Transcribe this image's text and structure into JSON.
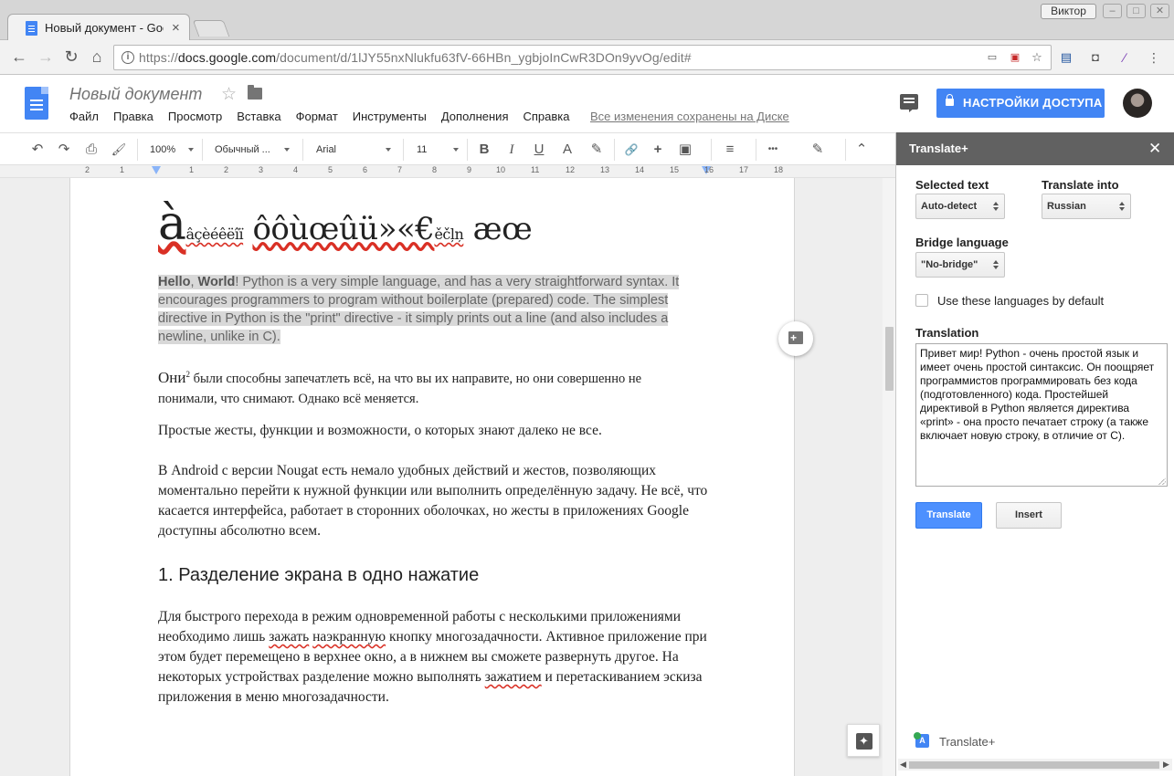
{
  "browser": {
    "tab_title": "Новый документ - Google Docs",
    "tab_close": "×",
    "user_name": "Виктор",
    "window_buttons": [
      "–",
      "□",
      "✕"
    ],
    "nav": {
      "back": "←",
      "forward": "→",
      "reload": "↻",
      "home": "⌂"
    },
    "url_prefix": "https://",
    "url_host": "docs.google.com",
    "url_path": "/document/d/1lJY55nxNlukfu63fV-66HBn_ygbjoInCwR3DOn9yvOg/edit#",
    "star": "☆",
    "menu_dots": "⋮"
  },
  "docs": {
    "title": "Новый документ",
    "star": "☆",
    "menu": [
      "Файл",
      "Правка",
      "Просмотр",
      "Вставка",
      "Формат",
      "Инструменты",
      "Дополнения",
      "Справка"
    ],
    "save_status": "Все изменения сохранены на Диске",
    "share_button": "НАСТРОЙКИ ДОСТУПА"
  },
  "toolbar": {
    "undo": "↶",
    "redo": "↷",
    "print": "⎙",
    "paint_format": "🖌",
    "zoom": "100%",
    "style": "Обычный ...",
    "font": "Arial",
    "size": "11",
    "bold": "B",
    "italic": "I",
    "underline": "U",
    "text_color": "A",
    "highlight": "✎",
    "link": "🔗",
    "comment": "+",
    "image": "▣",
    "align": "≡",
    "more": "•••",
    "edit_mode": "✎",
    "collapse": "⌃"
  },
  "ruler": {
    "labels": [
      "2",
      "1",
      "1",
      "2",
      "3",
      "4",
      "5",
      "6",
      "7",
      "8",
      "9",
      "10",
      "11",
      "12",
      "13",
      "14",
      "15",
      "16",
      "17",
      "18"
    ]
  },
  "document": {
    "chars_line_big": "à",
    "chars_line_small1": "âçèéêëîï",
    "chars_line_mid": "ôôùœûü»«€",
    "chars_line_small2": "ěčļņ",
    "chars_line_end": " æœ",
    "hello_bold1": "Hello",
    "hello_comma": ", ",
    "hello_bold2": "World",
    "hello_rest": "! Python is a very simple language, and has a very straightforward syntax. It encourages programmers to program without boilerplate (prepared) code. The simplest directive in Python is the \"print\" directive - it simply prints out a line (and also includes a newline, unlike in C).",
    "oni_word": "Они",
    "oni_sup": "2",
    "oni_rest": " были способны запечатлеть всё, на что вы их направите, но они совершенно не понимали, что снимают. Однако всё меняется.",
    "gestures": "Простые жесты, функции и возможности, о которых знают далеко не все.",
    "android": "В Android с версии Nougat есть немало удобных действий и жестов, позволяющих моментально перейти к нужной функции или выполнить определённую задачу. Не всё, что касается интерфейса, работает в сторонних оболочках, но жесты в приложениях Google доступны абсолютно всем.",
    "heading": "1. Разделение экрана в одно нажатие",
    "split_1": "Для быстрого перехода в режим одновременной работы с несколькими приложениями необходимо лишь ",
    "split_spell1": "зажать",
    "split_2": " ",
    "split_spell2": "наэкранную",
    "split_3": " кнопку многозадачности. Активное приложение при этом будет перемещено в верхнее окно, а в нижнем вы сможете развернуть другое. На некоторых устройствах разделение можно выполнять ",
    "split_spell3": "зажатием",
    "split_4": " и перетаскиванием эскиза приложения в меню многозадачности."
  },
  "sidebar": {
    "title": "Translate+",
    "close": "✕",
    "selected_text_label": "Selected text",
    "selected_text_value": "Auto-detect",
    "translate_into_label": "Translate into",
    "translate_into_value": "Russian",
    "bridge_label": "Bridge language",
    "bridge_value": "\"No-bridge\"",
    "default_checkbox_label": "Use these languages by default",
    "translation_label": "Translation",
    "translation_text": "Привет мир! Python - очень простой язык и имеет очень простой синтаксис. Он поощряет программистов программировать без кода (подготовленного) кода. Простейшей директивой в Python является директива «print» - она просто печатает строку (а также включает новую строку, в отличие от C).",
    "translate_button": "Translate",
    "insert_button": "Insert",
    "footer_icon": "A",
    "footer_text": "Translate+",
    "scroll_left": "◀",
    "scroll_right": "▶"
  },
  "colors": {
    "accent_blue": "#4285f4",
    "sidebar_header": "#616161",
    "selection_gray": "#d8d8d8",
    "spell_red": "#d93025"
  }
}
